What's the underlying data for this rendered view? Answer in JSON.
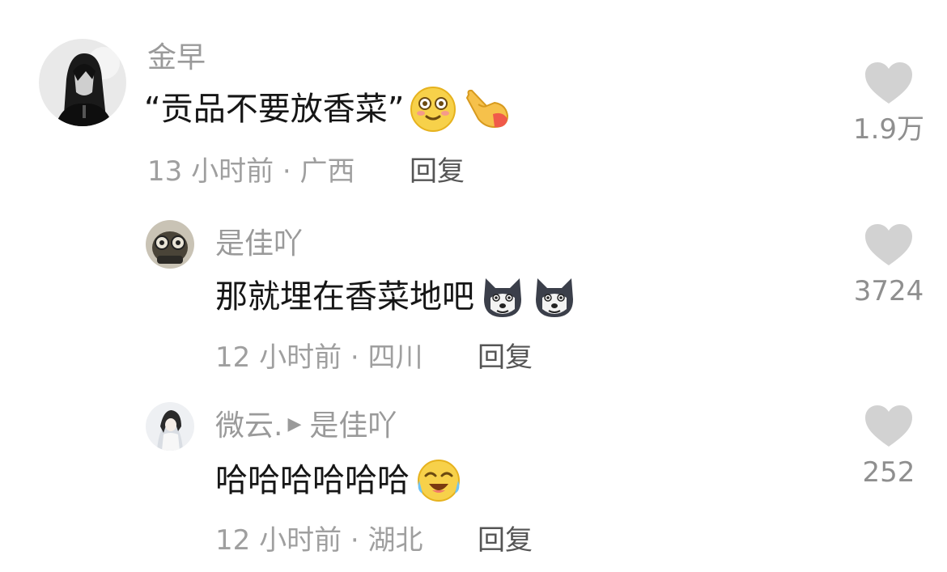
{
  "comments": [
    {
      "author": "金早",
      "text": "“贡品不要放香菜”",
      "emojis": [
        "shy-smile-emoji",
        "pointing-finger-emoji"
      ],
      "time_location": "13 小时前 · 广西",
      "reply_label": "回复",
      "likes": "1.9万"
    },
    {
      "author": "是佳吖",
      "text": "那就埋在香菜地吧",
      "emojis": [
        "husky-emoji",
        "husky-emoji"
      ],
      "time_location": "12 小时前 · 四川",
      "reply_label": "回复",
      "likes": "3724"
    },
    {
      "author": "微云.",
      "reply_to": "是佳吖",
      "text": "哈哈哈哈哈哈",
      "emojis": [
        "laugh-cry-emoji"
      ],
      "time_location": "12 小时前 · 湖北",
      "reply_label": "回复",
      "likes": "252"
    }
  ],
  "colors": {
    "heart": "#d2d2d2",
    "secondary_text": "#9a9a9a",
    "primary_text": "#161616"
  }
}
